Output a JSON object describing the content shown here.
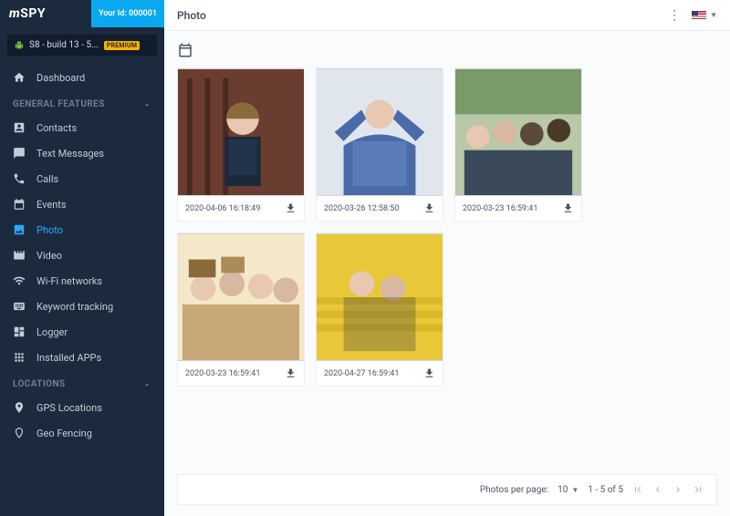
{
  "brand": {
    "name": "SPY",
    "prefix": "m"
  },
  "user_id_label": "Your Id: 000001",
  "device": {
    "name": "S8 - build 13 - 5...",
    "badge": "PREMIUM"
  },
  "nav": {
    "dashboard": "Dashboard",
    "sections": {
      "general": {
        "label": "GENERAL FEATURES",
        "items": {
          "contacts": "Contacts",
          "text_messages": "Text Messages",
          "calls": "Calls",
          "events": "Events",
          "photo": "Photo",
          "video": "Video",
          "wifi": "Wi-Fi networks",
          "keyword": "Keyword tracking",
          "logger": "Logger",
          "apps": "Installed APPs"
        }
      },
      "locations": {
        "label": "LOCATIONS",
        "items": {
          "gps": "GPS Locations",
          "geo": "Geo Fencing"
        }
      }
    }
  },
  "page": {
    "title": "Photo"
  },
  "photos": [
    {
      "ts": "2020-04-06 16:18:49"
    },
    {
      "ts": "2020-03-26 12:58:50"
    },
    {
      "ts": "2020-03-23 16:59:41"
    },
    {
      "ts": "2020-03-23 16:59:41"
    },
    {
      "ts": "2020-04-27 16:59:41"
    }
  ],
  "footer": {
    "per_page_label": "Photos per page:",
    "per_page_value": "10",
    "range": "1 - 5 of 5"
  }
}
